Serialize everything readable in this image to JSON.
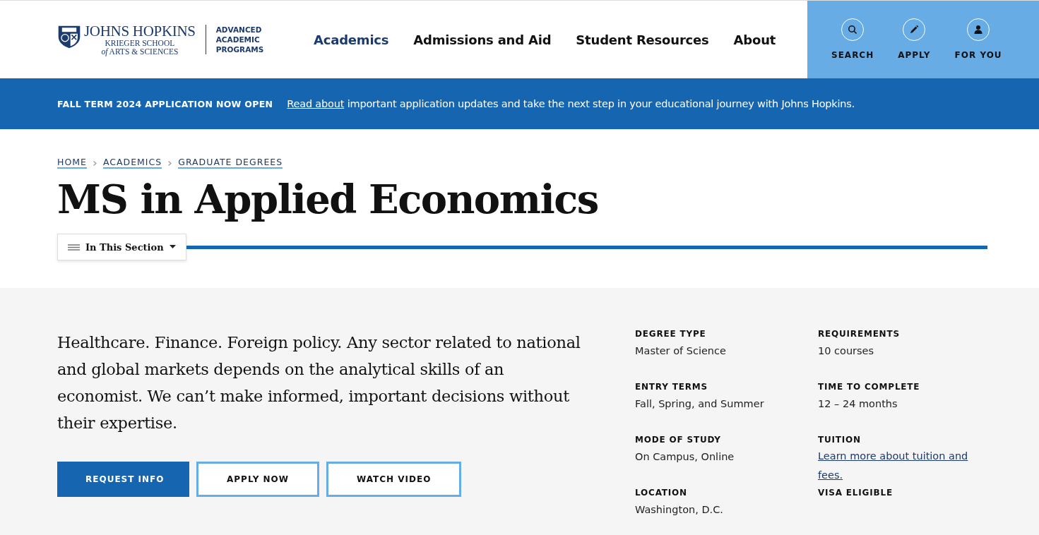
{
  "header": {
    "logo": {
      "name": "JOHNS HOPKINS",
      "school": "KRIEGER SCHOOL",
      "division": "*of* ARTS & SCIENCES",
      "program": "ADVANCED ACADEMIC PROGRAMS"
    },
    "nav": [
      {
        "label": "Academics",
        "selected": true
      },
      {
        "label": "Admissions and Aid",
        "selected": false
      },
      {
        "label": "Student Resources",
        "selected": false
      },
      {
        "label": "About",
        "selected": false
      }
    ],
    "utility": [
      {
        "label": "SEARCH",
        "kind": "search"
      },
      {
        "label": "APPLY",
        "kind": "apply"
      },
      {
        "label": "FOR YOU",
        "kind": "account"
      }
    ]
  },
  "banner": {
    "heading": "FALL TERM 2024 APPLICATION NOW OPEN",
    "link": "Read about",
    "text": "important application updates and take the next step in your educational journey with Johns Hopkins."
  },
  "breadcrumbs": [
    "HOME",
    "ACADEMICS",
    "GRADUATE DEGREES"
  ],
  "title": "MS in Applied Economics",
  "section_menu": {
    "label": "In This Section",
    "expanded": false
  },
  "intro": "Healthcare. Finance. Foreign policy. Any sector related to national and global markets depends on the analytical skills of an economist. We can’t make informed, important decisions without their expertise.",
  "buttons": [
    {
      "label": "REQUEST INFO",
      "kind": "primary"
    },
    {
      "label": "APPLY NOW",
      "kind": "outline"
    },
    {
      "label": "WATCH VIDEO",
      "kind": "outline"
    }
  ],
  "facts": [
    {
      "label": "DEGREE TYPE",
      "value": "Master of Science"
    },
    {
      "label": "REQUIREMENTS",
      "value": "10 courses"
    },
    {
      "label": "ENTRY TERMS",
      "value": "Fall, Spring, and Summer"
    },
    {
      "label": "TIME TO COMPLETE",
      "value": "12 – 24 months"
    },
    {
      "label": "MODE OF STUDY",
      "value": "On Campus, Online"
    },
    {
      "label": "TUITION",
      "link": "Learn more about tuition and fees."
    },
    {
      "label": "LOCATION",
      "value": "Washington, D.C."
    },
    {
      "label": "VISA ELIGIBLE"
    }
  ]
}
